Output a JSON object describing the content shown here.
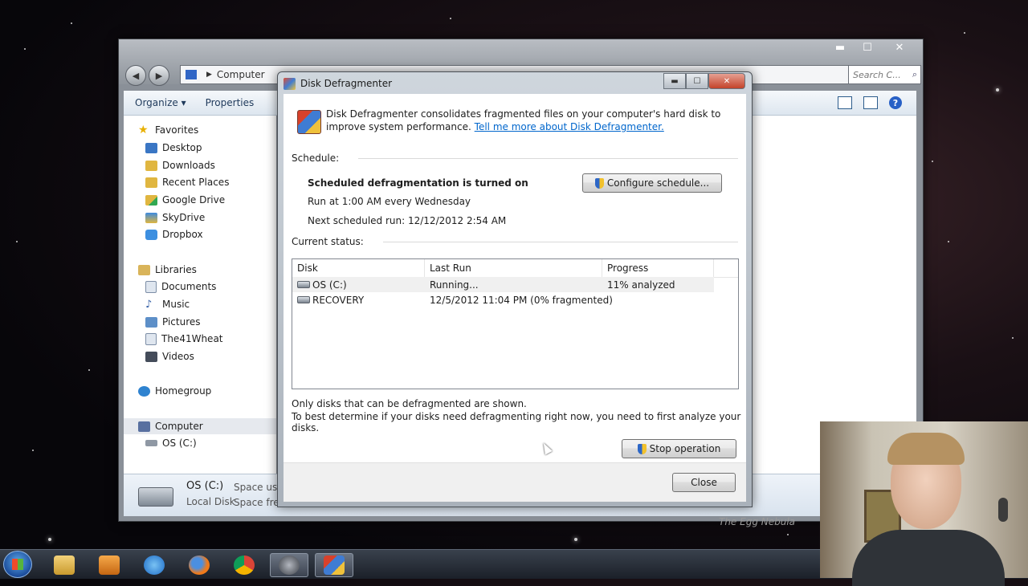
{
  "explorer": {
    "address": {
      "path": [
        "Computer"
      ]
    },
    "search": {
      "placeholder": "Search C..."
    },
    "toolbar": {
      "organize": "Organize ▾",
      "properties": "Properties"
    },
    "nav": {
      "favorites": "Favorites",
      "fav_items": [
        "Desktop",
        "Downloads",
        "Recent Places",
        "Google Drive",
        "SkyDrive",
        "Dropbox"
      ],
      "libraries": "Libraries",
      "lib_items": [
        "Documents",
        "Music",
        "Pictures",
        "The41Wheat",
        "Videos"
      ],
      "homegroup": "Homegroup",
      "computer": "Computer",
      "os_drive": "OS (C:)"
    },
    "details": {
      "name": "OS (C:)",
      "type": "Local Disk",
      "space_used": "Space use",
      "space_free": "Space fre"
    }
  },
  "dialog": {
    "title": "Disk Defragmenter",
    "intro_text": "Disk Defragmenter consolidates fragmented files on your computer's hard disk to improve system performance.",
    "intro_link": "Tell me more about Disk Defragmenter.",
    "schedule": {
      "heading": "Schedule:",
      "status": "Scheduled defragmentation is turned on",
      "run_at": "Run at 1:00 AM every Wednesday",
      "next_run": "Next scheduled run: 12/12/2012 2:54 AM",
      "configure_button": "Configure schedule..."
    },
    "current_status": {
      "heading": "Current status:",
      "columns": [
        "Disk",
        "Last Run",
        "Progress"
      ],
      "rows": [
        {
          "disk": "OS (C:)",
          "last_run": "Running...",
          "progress": "11% analyzed"
        },
        {
          "disk": "RECOVERY",
          "last_run": "12/5/2012 11:04 PM (0% fragmented)",
          "progress": ""
        }
      ]
    },
    "notes": {
      "line1": "Only disks that can be defragmented are shown.",
      "line2": "To best determine if your disks need defragmenting right now, you need to first analyze your disks."
    },
    "stop_button": "Stop operation",
    "close_button": "Close"
  },
  "wallpaper_caption": "The Egg Nebula"
}
